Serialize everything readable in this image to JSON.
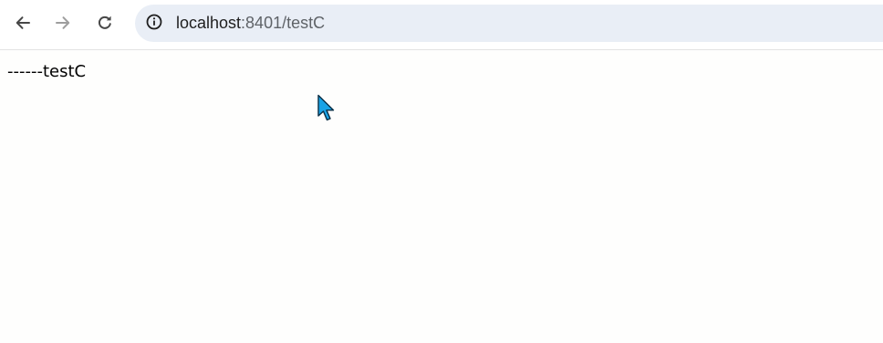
{
  "browser": {
    "url_host": "localhost",
    "url_rest": ":8401/testC",
    "icons": {
      "back": "arrow-left-icon",
      "forward": "arrow-right-icon",
      "reload": "reload-icon",
      "site_info": "info-icon"
    },
    "colors": {
      "omnibox_bg": "#e9eef6",
      "icon_active": "#474747",
      "icon_disabled": "#9e9e9e"
    }
  },
  "page": {
    "text": "------testC"
  },
  "cursor": {
    "icon": "mouse-pointer-icon",
    "color": "#1aa3e6"
  }
}
